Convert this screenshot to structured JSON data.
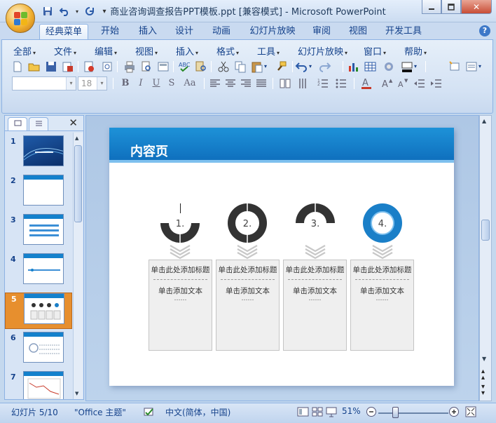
{
  "window": {
    "title": "商业咨询调查报告PPT模板.ppt [兼容模式] - Microsoft PowerPoint",
    "controls": [
      "minimize-icon",
      "maximize-icon",
      "close-icon"
    ]
  },
  "quick_access": [
    "save-icon",
    "undo-icon",
    "redo-icon",
    "customize-icon"
  ],
  "tabs": [
    "经典菜单",
    "开始",
    "插入",
    "设计",
    "动画",
    "幻灯片放映",
    "审阅",
    "视图",
    "开发工具"
  ],
  "active_tab": "经典菜单",
  "classic_menu": [
    "全部",
    "文件",
    "编辑",
    "视图",
    "插入",
    "格式",
    "工具",
    "幻灯片放映",
    "窗口",
    "帮助"
  ],
  "toolbar": {
    "font_name": "",
    "font_size": "18",
    "format_buttons": [
      "B",
      "I",
      "U",
      "S",
      "Aa"
    ]
  },
  "panel": {
    "tabs": [
      "slides-tab-icon",
      "outline-tab-icon"
    ],
    "close": "✕",
    "slides": [
      {
        "num": "1"
      },
      {
        "num": "2"
      },
      {
        "num": "3"
      },
      {
        "num": "4"
      },
      {
        "num": "5",
        "selected": true
      },
      {
        "num": "6"
      },
      {
        "num": "7"
      }
    ]
  },
  "slide": {
    "title": "内容页",
    "items": [
      {
        "number": "1.",
        "heading": "单击此处添加标题",
        "body": "单击添加文本",
        "dots": "……",
        "fill": 0.5,
        "highlight": false
      },
      {
        "number": "2.",
        "heading": "单击此处添加标题",
        "body": "单击添加文本",
        "dots": "……",
        "fill": 1.0,
        "highlight": false
      },
      {
        "number": "3.",
        "heading": "单击此处添加标题",
        "body": "单击添加文本",
        "dots": "……",
        "fill": 0.5,
        "highlight": false
      },
      {
        "number": "4.",
        "heading": "单击此处添加标题",
        "body": "单击添加文本",
        "dots": "……",
        "fill": 1.0,
        "highlight": true
      }
    ]
  },
  "status": {
    "slide_info": "幻灯片 5/10",
    "theme": "\"Office 主题\"",
    "language": "中文(简体，中国)",
    "zoom": "51%"
  },
  "colors": {
    "header_blue": "#1481cc",
    "ring_dark": "#333333",
    "ring_blue": "#1a7fc8",
    "selection_orange": "#e78f2e"
  }
}
